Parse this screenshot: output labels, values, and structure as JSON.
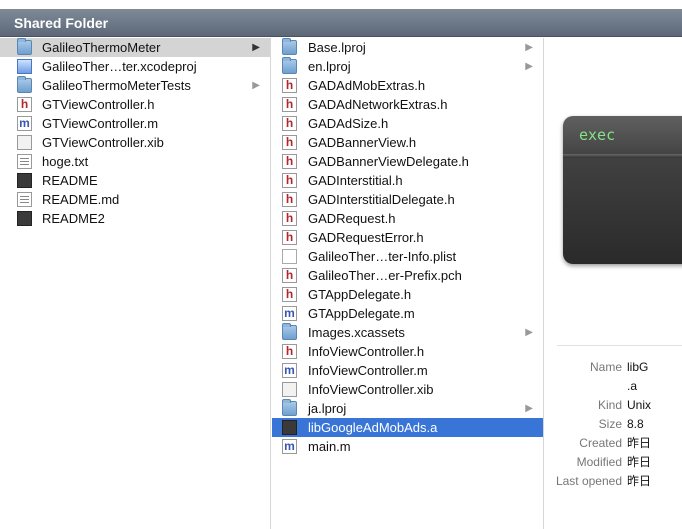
{
  "header": {
    "title": "Shared Folder"
  },
  "column1": [
    {
      "name": "GalileoThermoMeter",
      "icon": "folder",
      "chevron": true,
      "selected": "gray"
    },
    {
      "name": "GalileoTher…ter.xcodeproj",
      "icon": "xcodeproj",
      "chevron": false
    },
    {
      "name": "GalileoThermoMeterTests",
      "icon": "folder",
      "chevron": true
    },
    {
      "name": "GTViewController.h",
      "icon": "h",
      "chevron": false
    },
    {
      "name": "GTViewController.m",
      "icon": "m",
      "chevron": false
    },
    {
      "name": "GTViewController.xib",
      "icon": "xib",
      "chevron": false
    },
    {
      "name": "hoge.txt",
      "icon": "txt",
      "chevron": false
    },
    {
      "name": "README",
      "icon": "black",
      "chevron": false
    },
    {
      "name": "README.md",
      "icon": "txt",
      "chevron": false
    },
    {
      "name": "README2",
      "icon": "black",
      "chevron": false
    }
  ],
  "column2": [
    {
      "name": "Base.lproj",
      "icon": "folder",
      "chevron": true
    },
    {
      "name": "en.lproj",
      "icon": "folder",
      "chevron": true
    },
    {
      "name": "GADAdMobExtras.h",
      "icon": "h"
    },
    {
      "name": "GADAdNetworkExtras.h",
      "icon": "h"
    },
    {
      "name": "GADAdSize.h",
      "icon": "h"
    },
    {
      "name": "GADBannerView.h",
      "icon": "h"
    },
    {
      "name": "GADBannerViewDelegate.h",
      "icon": "h"
    },
    {
      "name": "GADInterstitial.h",
      "icon": "h"
    },
    {
      "name": "GADInterstitialDelegate.h",
      "icon": "h"
    },
    {
      "name": "GADRequest.h",
      "icon": "h"
    },
    {
      "name": "GADRequestError.h",
      "icon": "h"
    },
    {
      "name": "GalileoTher…ter-Info.plist",
      "icon": "plist"
    },
    {
      "name": "GalileoTher…er-Prefix.pch",
      "icon": "h"
    },
    {
      "name": "GTAppDelegate.h",
      "icon": "h"
    },
    {
      "name": "GTAppDelegate.m",
      "icon": "m"
    },
    {
      "name": "Images.xcassets",
      "icon": "folder",
      "chevron": true
    },
    {
      "name": "InfoViewController.h",
      "icon": "h"
    },
    {
      "name": "InfoViewController.m",
      "icon": "m"
    },
    {
      "name": "InfoViewController.xib",
      "icon": "xib"
    },
    {
      "name": "ja.lproj",
      "icon": "folder",
      "chevron": true
    },
    {
      "name": "libGoogleAdMobAds.a",
      "icon": "black",
      "selected": "blue"
    },
    {
      "name": "main.m",
      "icon": "m"
    }
  ],
  "preview": {
    "label": "exec"
  },
  "info": [
    {
      "label": "Name",
      "value": "libG"
    },
    {
      "label": "",
      "value": ".a"
    },
    {
      "label": "Kind",
      "value": "Unix"
    },
    {
      "label": "Size",
      "value": "8.8"
    },
    {
      "label": "Created",
      "value": "昨日"
    },
    {
      "label": "Modified",
      "value": "昨日"
    },
    {
      "label": "Last opened",
      "value": "昨日"
    }
  ],
  "colors": {
    "selection_blue": "#3875d7",
    "selection_gray": "#d4d4d4",
    "header": "#6b7686"
  }
}
